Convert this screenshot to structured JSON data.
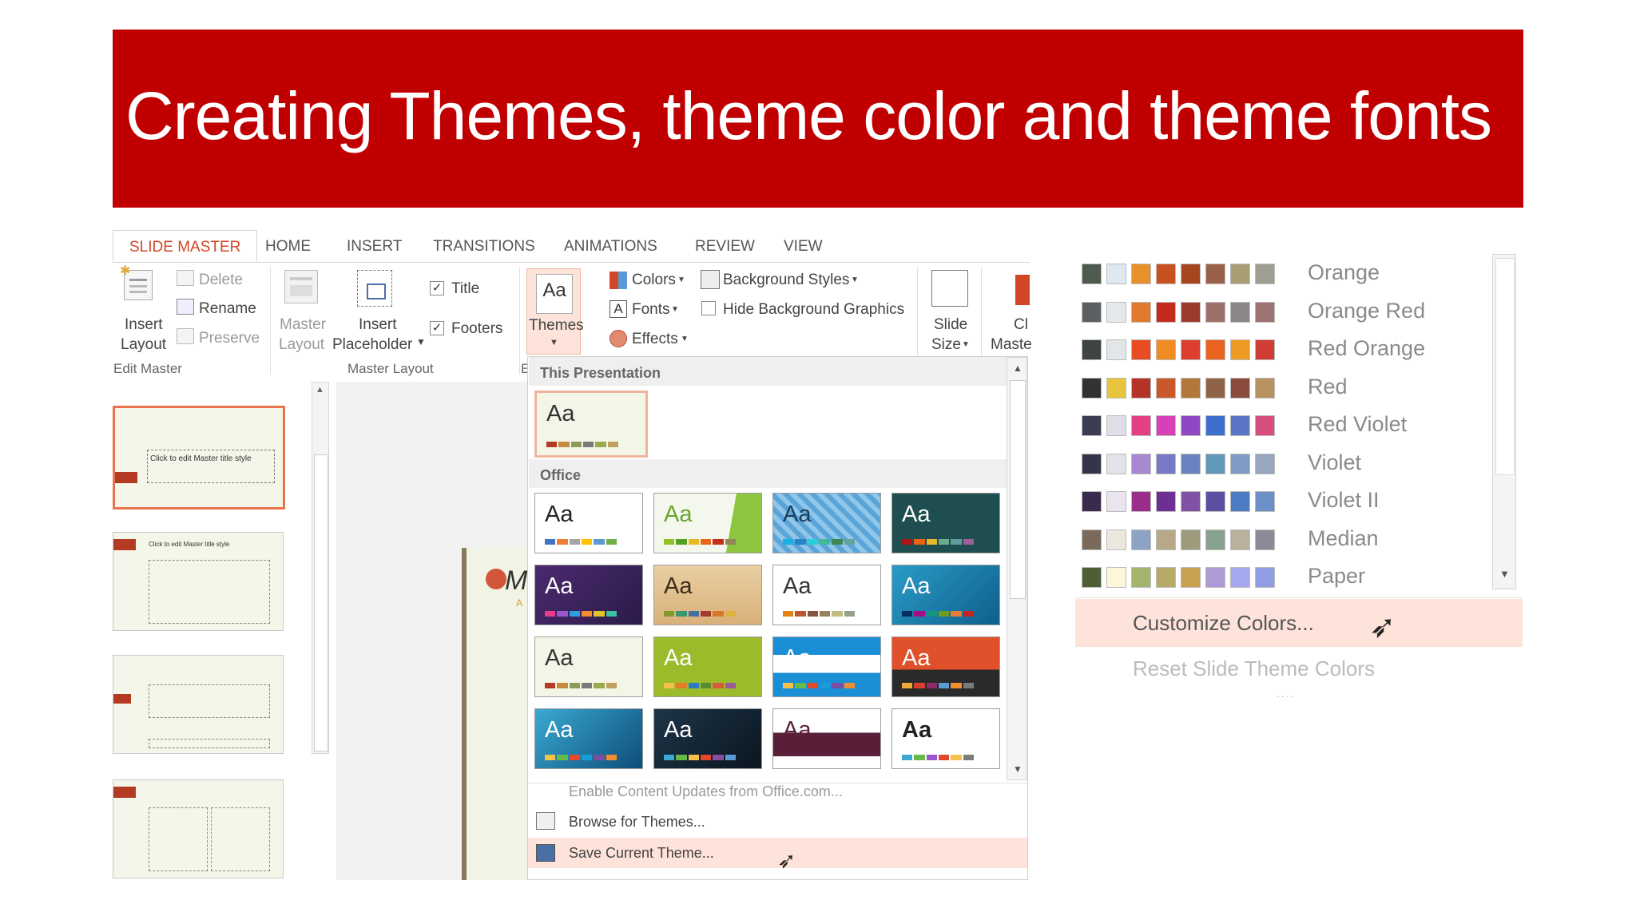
{
  "title": "Creating Themes, theme color and theme fonts",
  "tabs": [
    {
      "label": "SLIDE MASTER",
      "active": true
    },
    {
      "label": "HOME"
    },
    {
      "label": "INSERT"
    },
    {
      "label": "TRANSITIONS"
    },
    {
      "label": "ANIMATIONS"
    },
    {
      "label": "REVIEW"
    },
    {
      "label": "VIEW"
    }
  ],
  "ribbon": {
    "insert_slide_master": "Insert",
    "insert_layout_top": "Insert",
    "insert_layout_bottom": "Layout",
    "delete": "Delete",
    "rename": "Rename",
    "preserve": "Preserve",
    "group_edit_master": "Edit Master",
    "master_layout_top": "Master",
    "master_layout_bottom": "Layout",
    "insert_placeholder_top": "Insert",
    "insert_placeholder_bottom": "Placeholder",
    "title_check": "Title",
    "footers_check": "Footers",
    "group_master_layout": "Master Layout",
    "themes": "Themes",
    "colors": "Colors",
    "fonts": "Fonts",
    "effects": "Effects",
    "background_styles": "Background Styles",
    "hide_background_graphics": "Hide Background Graphics",
    "slide_size_top": "Slide",
    "slide_size_bottom": "Size",
    "close_top": "Cl",
    "close_bottom": "Maste",
    "group_cut": "E"
  },
  "thumbnails": {
    "master_title": "Click to edit Master title style",
    "layout_title": "Click to edit Master title style"
  },
  "canvas": {
    "partial_text": "M",
    "partial_sub": "A"
  },
  "gallery": {
    "section_this_presentation": "This Presentation",
    "section_office": "Office",
    "tile_label": "Aa",
    "enable_updates": "Enable Content Updates from Office.com...",
    "browse_themes": "Browse for Themes...",
    "save_theme": "Save Current Theme..."
  },
  "color_schemes": [
    {
      "name": "Orange",
      "swatches": [
        "#4e5b4f",
        "#dfe7f0",
        "#e8902b",
        "#c7521f",
        "#a6461f",
        "#99604a",
        "#a99e73",
        "#9f9e92"
      ]
    },
    {
      "name": "Orange Red",
      "swatches": [
        "#5c5f62",
        "#e6e9ec",
        "#e2782b",
        "#c52a1d",
        "#9a3b2b",
        "#9e706a",
        "#8c8686",
        "#9e7473"
      ]
    },
    {
      "name": "Red Orange",
      "swatches": [
        "#3e4442",
        "#e2e6e8",
        "#e84c22",
        "#f08c21",
        "#dc3f30",
        "#e86320",
        "#f09a26",
        "#d03d34"
      ]
    },
    {
      "name": "Red",
      "swatches": [
        "#323232",
        "#e8c33d",
        "#b43228",
        "#c9582a",
        "#b3773a",
        "#8f6446",
        "#8a4b3d",
        "#b89160"
      ]
    },
    {
      "name": "Red Violet",
      "swatches": [
        "#3a3d4f",
        "#dedfe6",
        "#e43e86",
        "#d740b9",
        "#8f47c4",
        "#3d6fcc",
        "#5c76c7",
        "#d64f7f"
      ]
    },
    {
      "name": "Violet",
      "swatches": [
        "#343548",
        "#e2e2ea",
        "#a888cf",
        "#7778c6",
        "#6a82c2",
        "#6198ba",
        "#7e9bc4",
        "#99a6bf"
      ]
    },
    {
      "name": "Violet II",
      "swatches": [
        "#3a2a4e",
        "#e9e4ee",
        "#9a2c8b",
        "#6d2f91",
        "#7f52a6",
        "#5a4fa1",
        "#4e7cc4",
        "#6b8fc6"
      ]
    },
    {
      "name": "Median",
      "swatches": [
        "#7a6a5c",
        "#ede8df",
        "#8ea2c4",
        "#b9a78a",
        "#9e9a7c",
        "#87a191",
        "#b9b19d",
        "#8c8a96"
      ]
    },
    {
      "name": "Paper",
      "swatches": [
        "#4f5f35",
        "#fbf7d8",
        "#a3b46f",
        "#b6aa64",
        "#c7a151",
        "#ae9ad4",
        "#a4a8ef",
        "#909de3"
      ]
    }
  ],
  "colors_menu": {
    "customize": "Customize Colors...",
    "reset": "Reset Slide Theme Colors"
  }
}
